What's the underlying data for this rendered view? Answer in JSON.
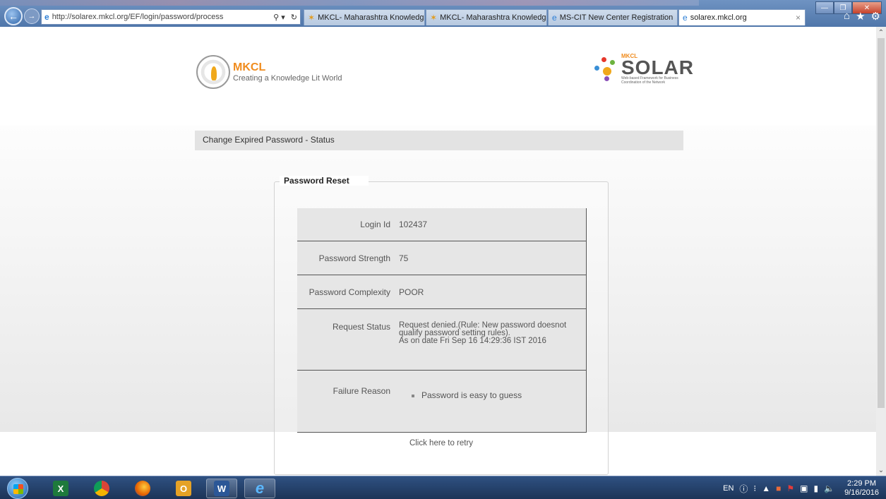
{
  "browser": {
    "url": "http://solarex.mkcl.org/EF/login/password/process",
    "tabs": [
      {
        "label": "MKCL- Maharashtra Knowledg..."
      },
      {
        "label": "MKCL- Maharashtra Knowledg..."
      },
      {
        "label": "MS-CIT New Center Registration"
      },
      {
        "label": "solarex.mkcl.org"
      }
    ]
  },
  "header": {
    "mkcl_name": "MKCL",
    "mkcl_tagline": "Creating a Knowledge Lit World",
    "solar_top": "MKCL",
    "solar_name": "SOLAR",
    "solar_sub": "Web-based Framework for Business Coordination of the Network"
  },
  "page": {
    "title": "Change Expired Password - Status",
    "panel_title": "Password Reset",
    "rows": [
      {
        "label": "Login Id",
        "value": "102437"
      },
      {
        "label": "Password Strength",
        "value": "75"
      },
      {
        "label": "Password Complexity",
        "value": "POOR"
      },
      {
        "label": "Request Status",
        "value_line1": "Request denied.(Rule: New password doesnot",
        "value_line2": "qualify password setting rules).",
        "value_line3": "As on date Fri Sep 16 14:29:36 IST 2016"
      },
      {
        "label": "Failure Reason",
        "value": "Password is easy to guess"
      }
    ],
    "retry": "Click here to retry"
  },
  "taskbar": {
    "lang": "EN",
    "time": "2:29 PM",
    "date": "9/16/2016"
  }
}
